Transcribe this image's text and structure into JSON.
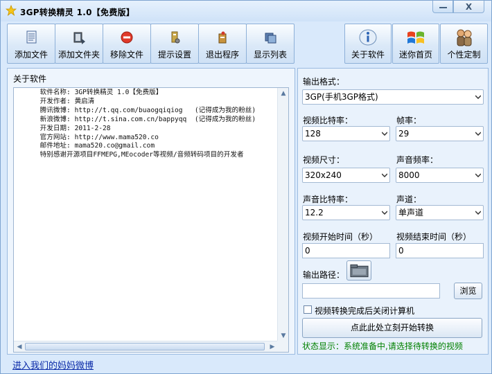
{
  "window": {
    "title": "3GP转换精灵 1.0【免费版】",
    "close_label": "X"
  },
  "toolbar": {
    "left": [
      {
        "label": "添加文件",
        "icon": "document-icon"
      },
      {
        "label": "添加文件夹",
        "icon": "folder-add-icon"
      },
      {
        "label": "移除文件",
        "icon": "remove-icon"
      },
      {
        "label": "提示设置",
        "icon": "settings-icon"
      },
      {
        "label": "退出程序",
        "icon": "exit-icon"
      },
      {
        "label": "显示列表",
        "icon": "list-icon"
      }
    ],
    "right": [
      {
        "label": "关于软件",
        "icon": "info-icon"
      },
      {
        "label": "迷你首页",
        "icon": "windows-logo-icon"
      },
      {
        "label": "个性定制",
        "icon": "people-icon"
      }
    ]
  },
  "left_panel": {
    "label": "关于软件",
    "about_lines": [
      "      软件名称: 3GP转换精灵 1.0【免费版】",
      "      开发作者: 黄启清",
      "      腾讯微博: http://t.qq.com/buaogqiqiog   (记得成为我的粉丝)",
      "      新浪微博: http://t.sina.com.cn/bappyqq  (记得成为我的粉丝)",
      "      开发日期: 2011-2-28",
      "      官方网站: http://www.mama520.co",
      "      邮件地址: mama520.co@gmail.com",
      "      特别感谢开源项目FFMEPG,MEocoder等视频/音频转码项目的开发者"
    ]
  },
  "settings": {
    "output_format_label": "输出格式：",
    "output_format_value": "3GP(手机3GP格式)",
    "video_bitrate_label": "视频比特率：",
    "video_bitrate_value": "128",
    "frame_rate_label": "帧率：",
    "frame_rate_value": "29",
    "video_size_label": "视频尺寸：",
    "video_size_value": "320x240",
    "audio_freq_label": "声音频率：",
    "audio_freq_value": "8000",
    "audio_bitrate_label": "声音比特率：",
    "audio_bitrate_value": "12.2",
    "channel_label": "声道：",
    "channel_value": "单声道",
    "start_time_label": "视频开始时间（秒）",
    "start_time_value": "0",
    "end_time_label": "视频结束时间（秒）",
    "end_time_value": "0",
    "output_path_label": "输出路径：",
    "output_path_value": "",
    "browse_label": "浏览",
    "shutdown_label": "视频转换完成后关闭计算机",
    "convert_label": "点此此处立刻开始转换",
    "status_text": "状态显示：系统准备中,请选择待转换的视频"
  },
  "footer": {
    "link_text": "进入我们的妈妈微博"
  }
}
